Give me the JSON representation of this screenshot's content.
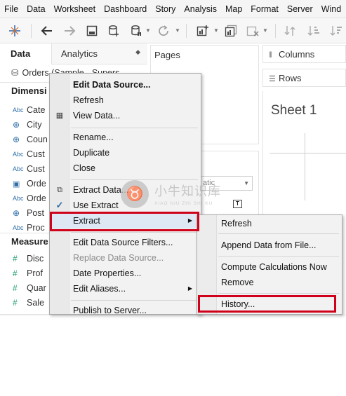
{
  "menubar": {
    "items": [
      "File",
      "Data",
      "Worksheet",
      "Dashboard",
      "Story",
      "Analysis",
      "Map",
      "Format",
      "Server",
      "Wind"
    ]
  },
  "left_pane": {
    "tab_data": "Data",
    "tab_analytics": "Analytics",
    "datasource": "Orders (Sample - Supers",
    "dimensions_header": "Dimensi",
    "measures_header": "Measure",
    "dimensions": [
      {
        "icon": "Abc",
        "label": "Cate"
      },
      {
        "icon": "globe",
        "label": "City"
      },
      {
        "icon": "globe",
        "label": "Coun"
      },
      {
        "icon": "Abc",
        "label": "Cust"
      },
      {
        "icon": "Abc",
        "label": "Cust"
      },
      {
        "icon": "calendar",
        "label": "Orde"
      },
      {
        "icon": "Abc",
        "label": "Orde"
      },
      {
        "icon": "globe",
        "label": "Post"
      },
      {
        "icon": "Abc",
        "label": "Proc"
      }
    ],
    "measures": [
      {
        "icon": "#",
        "label": "Disc"
      },
      {
        "icon": "#",
        "label": "Prof"
      },
      {
        "icon": "#",
        "label": "Quar"
      },
      {
        "icon": "#",
        "label": "Sale"
      }
    ]
  },
  "center": {
    "pages_label": "Pages",
    "marks_select_value": "atic",
    "text_icon_label": "T"
  },
  "shelves": {
    "columns_label": "Columns",
    "rows_label": "Rows"
  },
  "sheet": {
    "title": "Sheet 1"
  },
  "context_menu": {
    "items": [
      {
        "label": "Edit Data Source...",
        "style": "bold"
      },
      {
        "label": "Refresh"
      },
      {
        "label": "View Data...",
        "icon": "grid"
      },
      {
        "label": "Rename..."
      },
      {
        "label": "Duplicate"
      },
      {
        "label": "Close"
      },
      {
        "label": "Extract Data...",
        "icon": "extract"
      },
      {
        "label": "Use Extract",
        "icon": "check"
      },
      {
        "label": "Extract",
        "has_submenu": true,
        "highlighted": true
      },
      {
        "label": "Edit Data Source Filters..."
      },
      {
        "label": "Replace Data Source...",
        "style": "disabled"
      },
      {
        "label": "Date Properties..."
      },
      {
        "label": "Edit Aliases...",
        "has_submenu": true
      },
      {
        "label": "Publish to Server..."
      }
    ]
  },
  "submenu": {
    "items": [
      {
        "label": "Refresh"
      },
      {
        "label": "Append Data from File..."
      },
      {
        "label": "Compute Calculations Now"
      },
      {
        "label": "Remove"
      },
      {
        "label": "History..."
      }
    ]
  },
  "watermark": {
    "text": "小牛知识库",
    "subtext": "XIAO NIU ZHI SHI KU"
  },
  "colors": {
    "highlight_border": "#d0021b",
    "menu_background": "#f2f2f2",
    "selection": "#dde8f4",
    "dimension_icon": "#2e6ea8",
    "measure_icon": "#1d9c6b"
  }
}
